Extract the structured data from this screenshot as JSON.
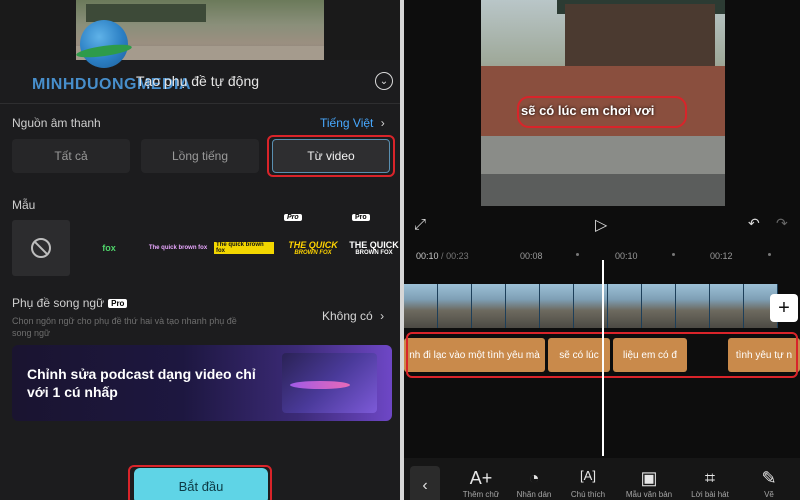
{
  "left": {
    "watermark": "MINHDUONGMEDIA",
    "sheet_title": "Tạo phụ đề tự động",
    "audio_source": {
      "label": "Nguồn âm thanh",
      "value": "Tiếng Việt",
      "options": [
        "Tất cả",
        "Lồng tiếng",
        "Từ video"
      ],
      "selected": "Từ video"
    },
    "templates": {
      "label": "Mẫu",
      "items": [
        {
          "text": "",
          "icon": "none-icon"
        },
        {
          "text": "fox"
        },
        {
          "text": "The quick brown fox"
        },
        {
          "text": "The quick brown fox"
        },
        {
          "text": "THE QUICK",
          "sub": "BROWN FOX",
          "badge": "Pro"
        },
        {
          "text": "THE QUICK",
          "sub": "BROWN FOX",
          "badge": "Pro"
        }
      ]
    },
    "bilingual": {
      "label": "Phụ đề song ngữ",
      "badge": "Pro",
      "note": "Chọn ngôn ngữ cho phụ đề thứ hai và tạo nhanh phụ đề song ngữ",
      "value": "Không có"
    },
    "promo": {
      "text": "Chỉnh sửa podcast dạng video chỉ với 1 cú nhấp"
    },
    "start_button": "Bắt đầu"
  },
  "right": {
    "caption": "sẽ có lúc em chơi vơi",
    "timecode_current": "00:10",
    "timecode_total": "00:23",
    "ticks": [
      "00:08",
      "00:10",
      "00:12"
    ],
    "subtitle_clips": [
      "nh đi lạc vào một tình yêu mà",
      "sẽ có lúc",
      "liệu em có đ",
      "tình yêu tự n"
    ],
    "tools": [
      {
        "icon": "add-text-icon",
        "glyph": "A+",
        "label": "Thêm chữ"
      },
      {
        "icon": "sticker-icon",
        "glyph": "◔",
        "label": "Nhãn dán"
      },
      {
        "icon": "caption-icon",
        "glyph": "[A]",
        "label": "Chú thích"
      },
      {
        "icon": "text-template-icon",
        "glyph": "▣",
        "label": "Mẫu văn bản"
      },
      {
        "icon": "lyrics-icon",
        "glyph": "⌗",
        "label": "Lời bài hát"
      },
      {
        "icon": "draw-icon",
        "glyph": "✎",
        "label": "Vẽ"
      }
    ]
  },
  "colors": {
    "accent_blue": "#48a9ff",
    "highlight_red": "#d9242a",
    "start_button": "#5fd4e6",
    "subtitle_clip": "#c98a4b"
  }
}
